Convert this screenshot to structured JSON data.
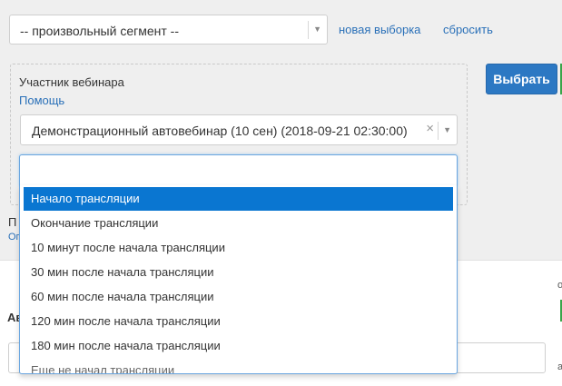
{
  "segment": {
    "selected": "-- произвольный сегмент --"
  },
  "links": {
    "new_selection": "новая выборка",
    "reset": "сбросить",
    "help": "Помощь"
  },
  "filter": {
    "label": "Участник вебинара",
    "webinar_value": "Демонстрационный автовебинар (10 сен) (2018-09-21 02:30:00)",
    "clear_glyph": "×",
    "arrow_glyph": "▼"
  },
  "actions": {
    "choose_label": "Выбрать"
  },
  "dropdown": {
    "search_value": "",
    "options": [
      "Начало трансляции",
      "Окончание трансляции",
      "10 минут после начала трансляции",
      "30 мин после начала трансляции",
      "60 мин после начала трансляции",
      "120 мин после начала трансляции",
      "180 мин после начала трансляции",
      "Еще не начал трансляции"
    ],
    "selected_index": 0
  },
  "background": {
    "p_fragment": "П",
    "link_fragment": "Ог",
    "bold_fragment": "Ав",
    "right_fragment_1": "о",
    "right_fragment_2": "",
    "right_fragment_3": "а"
  },
  "colors": {
    "accent": "#2c78c3",
    "selected_option": "#0a76d1",
    "link": "#2a70b8",
    "green": "#3aa54a"
  }
}
